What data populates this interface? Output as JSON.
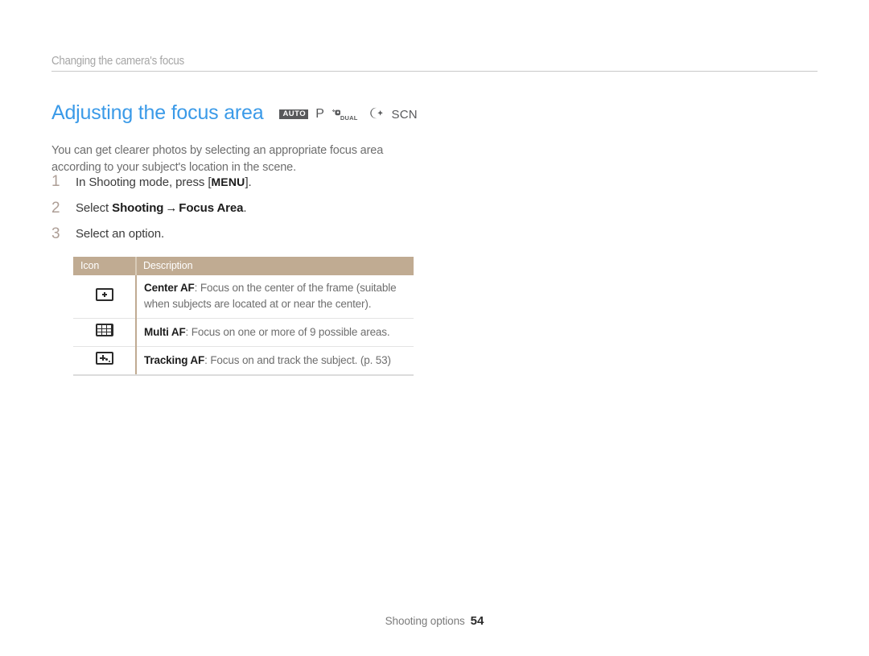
{
  "document": {
    "running_header": "Changing the camera's focus",
    "section_title": "Adjusting the focus area",
    "mode_icons": [
      {
        "name": "auto-mode-icon",
        "label": "AUTO"
      },
      {
        "name": "program-mode-icon",
        "label": "P"
      },
      {
        "name": "dual-is-mode-icon",
        "glyph": "ᴴ",
        "label": "DUAL"
      },
      {
        "name": "night-mode-icon",
        "glyph": "☾✶"
      },
      {
        "name": "scene-mode-icon",
        "label": "SCN"
      }
    ],
    "intro": "You can get clearer photos by selecting an appropriate focus area according to your subject's location in the scene.",
    "steps": [
      {
        "number": "1",
        "prefix": "In Shooting mode, press [",
        "key": "MENU",
        "suffix": "]."
      },
      {
        "number": "2",
        "prefix": "Select ",
        "bold1": "Shooting",
        "arrow": "→",
        "bold2": "Focus Area",
        "suffix": "."
      },
      {
        "number": "3",
        "prefix": "Select an option."
      }
    ],
    "table": {
      "headers": [
        "Icon",
        "Description"
      ],
      "rows": [
        {
          "icon_name": "center-af-icon",
          "term": "Center AF",
          "description": ": Focus on the center of the frame (suitable when subjects are located at or near the center)."
        },
        {
          "icon_name": "multi-af-icon",
          "term": "Multi AF",
          "description": ": Focus on one or more of 9 possible areas."
        },
        {
          "icon_name": "tracking-af-icon",
          "term": "Tracking AF",
          "description": ": Focus on and track the subject. (p. 53)"
        }
      ]
    },
    "footer": {
      "label": "Shooting options",
      "page": "54"
    },
    "colors": {
      "title_blue": "#3a9ae8",
      "header_gray": "#a6a6a6",
      "table_header_tan": "#c0ab92",
      "step_number_tan": "#ad9e96",
      "body_gray": "#6e6e6e"
    }
  }
}
